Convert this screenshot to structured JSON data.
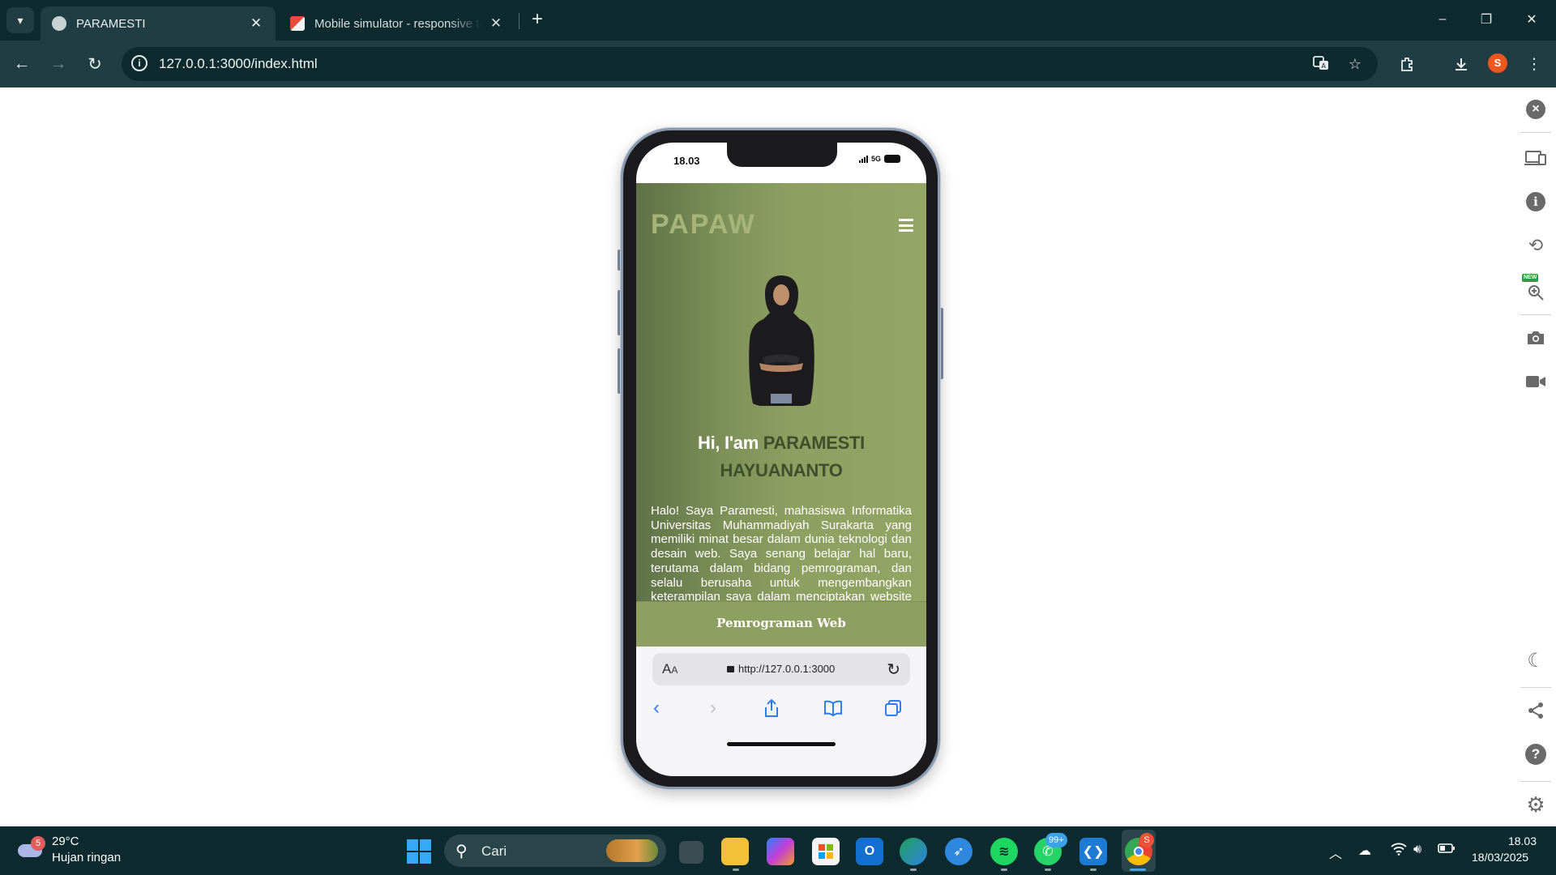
{
  "browser": {
    "tabs": [
      {
        "title": "PARAMESTI",
        "close": "✕"
      },
      {
        "title": "Mobile simulator - responsive testing",
        "close": "✕"
      }
    ],
    "new_tab": "+",
    "window_controls": {
      "minimize": "–",
      "restore": "❐",
      "close": "✕"
    },
    "nav": {
      "back": "←",
      "forward": "→",
      "reload": "↻"
    },
    "url": "127.0.0.1:3000/index.html",
    "info_glyph": "i",
    "profile_initial": "S",
    "accent": "#0d2a2f",
    "toolbar_color": "#1f3d42"
  },
  "simulator_rail": {
    "buttons": [
      "close-icon",
      "devices-icon",
      "info-icon",
      "rotate-icon",
      "zoom-icon",
      "camera-icon",
      "video-icon",
      "dark-mode-icon",
      "share-icon",
      "help-icon",
      "settings-icon"
    ],
    "new_badge": "NEW"
  },
  "phone": {
    "status_time": "18.03",
    "network": "5G",
    "site": {
      "logo": "PAPAW",
      "hero_greeting": "Hi, I'am",
      "hero_name": "PARAMESTI HAYUANANTO",
      "hero_text": "Halo! Saya Paramesti, mahasiswa Informatika Universitas Muhammadiyah Surakarta yang memiliki minat besar dalam dunia teknologi dan desain web. Saya senang belajar hal baru, terutama dalam bidang pemrograman, dan selalu berusaha untuk mengembangkan keterampilan saya dalam menciptakan website yang menarik. Saat ini, saya sedang memperdalam",
      "footer": "Pemrograman Web",
      "accent": "#8ea061",
      "name_color": "#3f4f2c"
    },
    "safari": {
      "aa_big": "A",
      "aa_small": "A",
      "url": "http://127.0.0.1:3000",
      "reload": "↻"
    }
  },
  "taskbar": {
    "weather": {
      "badge": "5",
      "temp": "29°C",
      "desc": "Hujan ringan"
    },
    "search_placeholder": "Cari",
    "whatsapp_badge": "99+",
    "chrome_badge": "S",
    "clock": {
      "time": "18.03",
      "date": "18/03/2025"
    }
  }
}
